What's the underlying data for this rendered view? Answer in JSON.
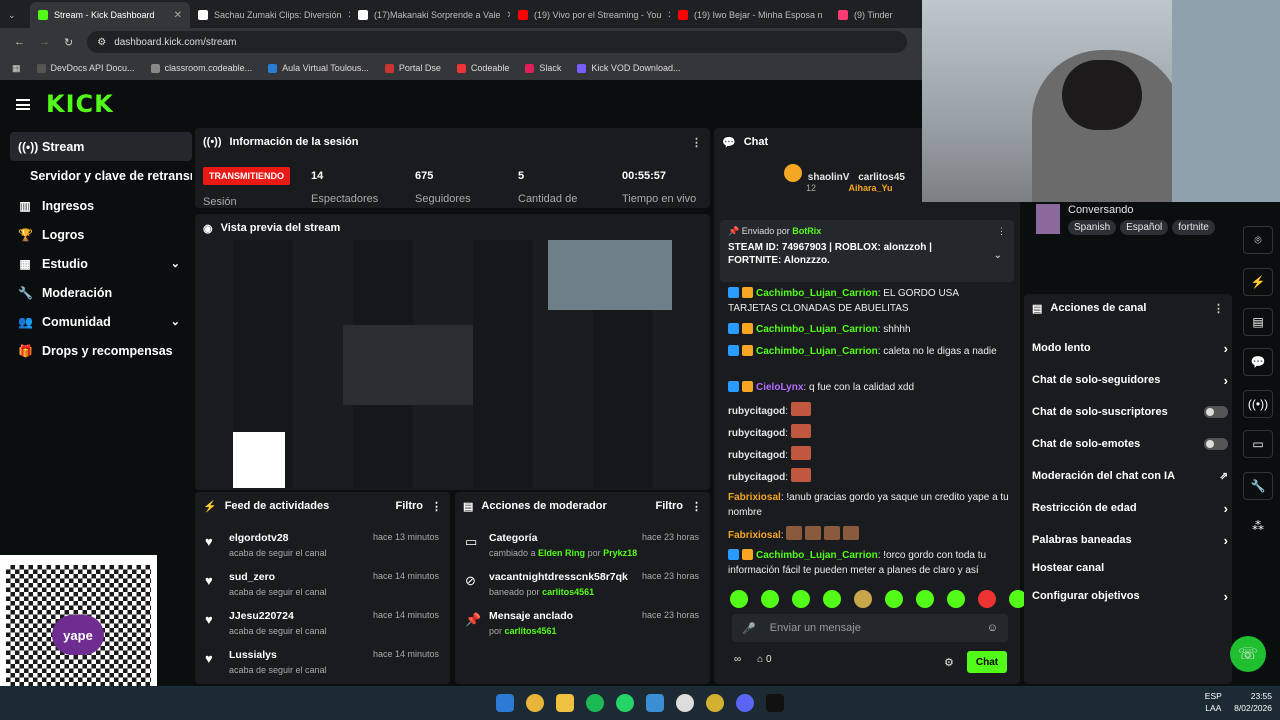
{
  "browser": {
    "tabs": [
      {
        "title": "Stream - Kick Dashboard",
        "color": "#53fc18",
        "active": true
      },
      {
        "title": "Sachau Zumaki Clips: Diversión",
        "color": "#ffffff"
      },
      {
        "title": "(17)Makanaki Sorprende a Vale",
        "color": "#ffffff"
      },
      {
        "title": "(19) Vivo por el Streaming - You",
        "color": "#ff0000"
      },
      {
        "title": "(19) Iwo Bejar - Minha Esposa n",
        "color": "#ff0000"
      },
      {
        "title": "(9) Tinder",
        "color": "#fe3c72"
      }
    ],
    "url": "dashboard.kick.com/stream",
    "bookmarks": [
      "DevDocs API Docu...",
      "classroom.codeable...",
      "Aula Virtual Toulous...",
      "Portal Dse",
      "Codeable",
      "Slack",
      "Kick VOD Download..."
    ]
  },
  "brand": {
    "logo": "KICK",
    "accent": "#53fc18"
  },
  "sidebar": {
    "items": [
      {
        "label": "Stream",
        "icon": "broadcast-icon"
      },
      {
        "label": "Servidor y clave de retransmisión",
        "icon": ""
      },
      {
        "label": "Ingresos",
        "icon": "chart-icon"
      },
      {
        "label": "Logros",
        "icon": "trophy-icon"
      },
      {
        "label": "Estudio",
        "icon": "grid-icon"
      },
      {
        "label": "Moderación",
        "icon": "wrench-icon"
      },
      {
        "label": "Comunidad",
        "icon": "users-icon"
      },
      {
        "label": "Drops y recompensas",
        "icon": "gift-icon"
      }
    ]
  },
  "session": {
    "title": "Información de la sesión",
    "live_badge": "TRANSMITIENDO",
    "status_label": "Sesión",
    "stats": [
      {
        "value": "14",
        "label": "Espectadores"
      },
      {
        "value": "675",
        "label": "Seguidores"
      },
      {
        "value": "5",
        "label": "Cantidad de"
      },
      {
        "value": "00:55:57",
        "label": "Tiempo en vivo"
      }
    ]
  },
  "preview": {
    "title": "Vista previa del stream"
  },
  "feed": {
    "title": "Feed de actividades",
    "filter": "Filtro",
    "items": [
      {
        "name": "elgordotv28",
        "sub": "acaba de seguir el canal",
        "time": "hace 13 minutos"
      },
      {
        "name": "sud_zero",
        "sub": "acaba de seguir el canal",
        "time": "hace 14 minutos"
      },
      {
        "name": "JJesu220724",
        "sub": "acaba de seguir el canal",
        "time": "hace 14 minutos"
      },
      {
        "name": "Lussialys",
        "sub": "acaba de seguir el canal",
        "time": "hace 14 minutos"
      }
    ]
  },
  "mod_actions": {
    "title": "Acciones de moderador",
    "filter": "Filtro",
    "items": [
      {
        "name": "Categoría",
        "sub_pre": "cambiado a",
        "sub_a": "Elden Ring",
        "sub_mid": "por",
        "sub_b": "Prykz18",
        "time": "hace 23 horas"
      },
      {
        "name": "vacantnightdresscnk58r7qk",
        "sub_pre": "baneado por",
        "sub_a": "carlitos4561",
        "sub_mid": "",
        "sub_b": "",
        "time": "hace 23 horas"
      },
      {
        "name": "Mensaje anclado",
        "sub_pre": "por",
        "sub_a": "carlitos4561",
        "sub_mid": "",
        "sub_b": "",
        "time": "hace 23 horas"
      }
    ]
  },
  "chat": {
    "title": "Chat",
    "top_users": [
      "shaolinV",
      "carlitos45",
      "Aihara_Yu"
    ],
    "top_count": "12",
    "pinned_by_label": "Enviado por",
    "pinned_by": "BotRix",
    "pinned_text": "STEAM ID: 74967903 | ROBLOX: alonzzoh | FORTNITE: Alonzzzo.",
    "messages": [
      {
        "user": "Cachimbo_Lujan_Carrion",
        "text": "EL GORDO USA TARJETAS CLONADAS DE ABUELITAS",
        "cls": "u-green"
      },
      {
        "user": "Cachimbo_Lujan_Carrion",
        "text": "shhhh",
        "cls": "u-green"
      },
      {
        "user": "Cachimbo_Lujan_Carrion",
        "text": "caleta no le digas a nadie",
        "cls": "u-green"
      },
      {
        "user": "CieloLynx",
        "text": "q fue con la calidad xdd",
        "cls": "u-purple"
      },
      {
        "user": "rubycitagod",
        "text": "",
        "cls": "u-pink"
      },
      {
        "user": "rubycitagod",
        "text": "",
        "cls": "u-pink"
      },
      {
        "user": "rubycitagod",
        "text": "",
        "cls": "u-pink"
      },
      {
        "user": "rubycitagod",
        "text": "",
        "cls": "u-pink"
      },
      {
        "user": "Fabrixiosal",
        "text": "!anub gracias gordo ya saque un credito yape a tu nombre",
        "cls": "u-orange"
      },
      {
        "user": "Fabrixiosal",
        "text": "",
        "cls": "u-orange"
      },
      {
        "user": "Cachimbo_Lujan_Carrion",
        "text": "!orco gordo con toda tu información fácil te pueden meter a planes de claro y así",
        "cls": "u-green"
      }
    ],
    "input_placeholder": "Enviar un mensaje",
    "viewer_count": "0",
    "send_label": "Chat"
  },
  "channel_actions": {
    "conversing": "Conversando",
    "tags": [
      "Spanish",
      "Español",
      "fortnite"
    ],
    "title": "Acciones de canal",
    "items": [
      {
        "label": "Modo lento",
        "kind": "arrow"
      },
      {
        "label": "Chat de solo-seguidores",
        "kind": "arrow"
      },
      {
        "label": "Chat de solo-suscriptores",
        "kind": "toggle"
      },
      {
        "label": "Chat de solo-emotes",
        "kind": "toggle"
      },
      {
        "label": "Moderación del chat con IA",
        "kind": "external"
      },
      {
        "label": "Restricción de edad",
        "kind": "arrow"
      },
      {
        "label": "Palabras baneadas",
        "kind": "arrow"
      },
      {
        "label": "Hostear canal",
        "kind": "none"
      },
      {
        "label": "Configurar objetivos",
        "kind": "arrow"
      }
    ]
  },
  "taskbar": {
    "lang": "ESP",
    "region": "LAA",
    "time": "23:55",
    "date": "8/02/2026"
  },
  "qr_brand": "yape"
}
